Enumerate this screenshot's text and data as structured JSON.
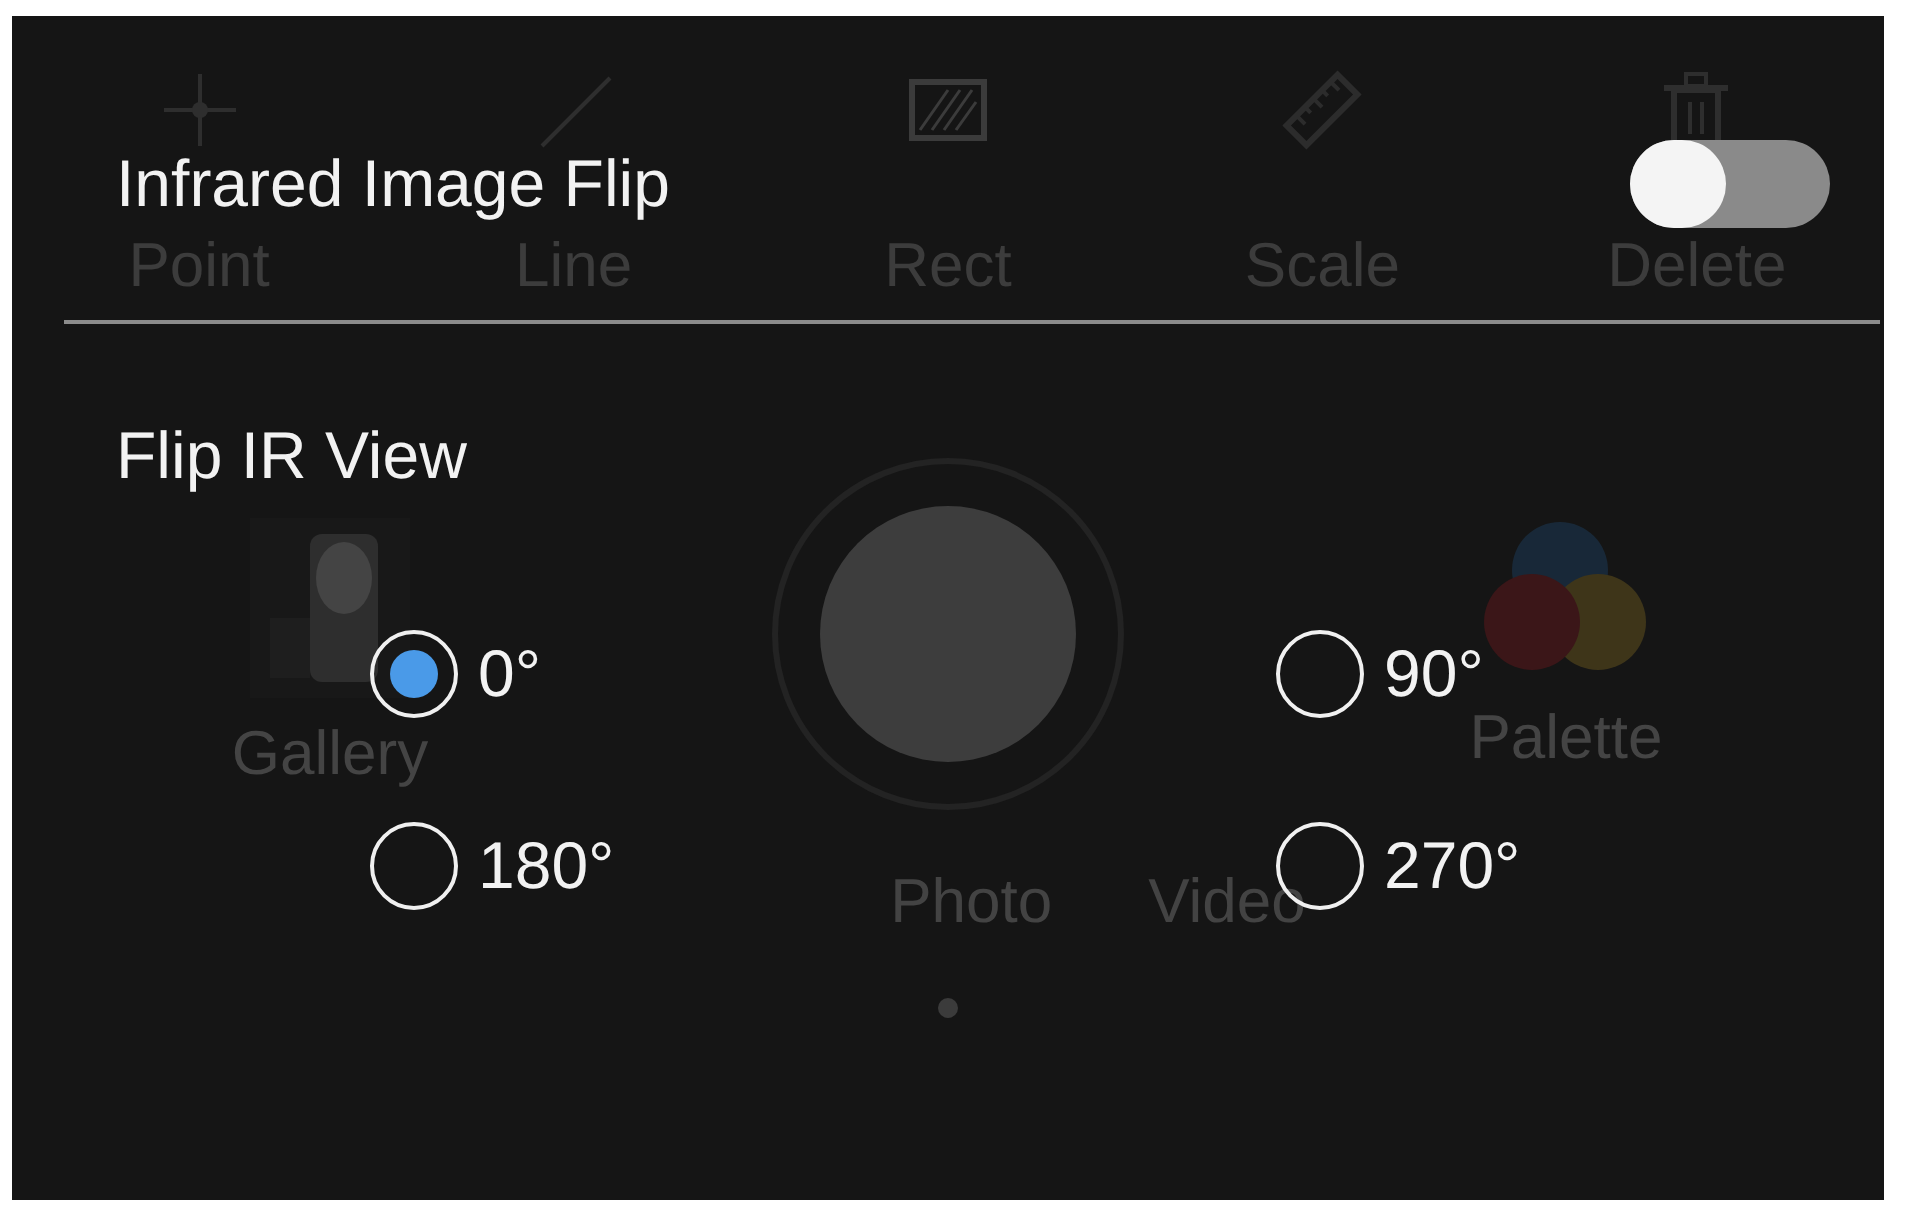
{
  "toolbar": [
    {
      "kind": "point",
      "label": "Point"
    },
    {
      "kind": "line",
      "label": "Line"
    },
    {
      "kind": "rect",
      "label": "Rect"
    },
    {
      "kind": "scale",
      "label": "Scale"
    },
    {
      "kind": "delete",
      "label": "Delete"
    }
  ],
  "camera": {
    "gallery": "Gallery",
    "palette": "Palette",
    "modes": [
      "Photo",
      "Video"
    ]
  },
  "dialog": {
    "title": "Infrared Image Flip",
    "toggle_on": false,
    "section": "Flip IR View",
    "options": [
      {
        "label": "0°",
        "selected": true
      },
      {
        "label": "90°",
        "selected": false
      },
      {
        "label": "180°",
        "selected": false
      },
      {
        "label": "270°",
        "selected": false
      }
    ]
  }
}
